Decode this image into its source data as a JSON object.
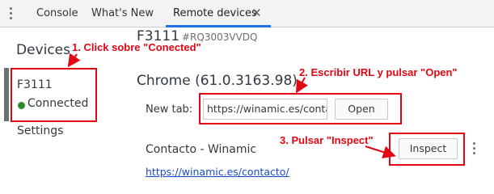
{
  "tabs": [
    {
      "label": "Console",
      "active": false
    },
    {
      "label": "What's New",
      "active": false
    },
    {
      "label": "Remote devices",
      "active": true
    }
  ],
  "sidebar": {
    "title": "Devices",
    "device": {
      "name": "F3111",
      "status": "Connected"
    },
    "settings_label": "Settings"
  },
  "device_panel": {
    "model": "F3111",
    "serial": "#RQ3003VVDQ",
    "browser": "Chrome (61.0.3163.98)",
    "new_tab_label": "New tab:",
    "url_value": "https://winamic.es/contacto/",
    "open_label": "Open",
    "page": {
      "title": "Contacto - Winamic",
      "url": "https://winamic.es/contacto/",
      "inspect_label": "Inspect"
    }
  },
  "annotations": {
    "step1": "1. Click sobre \"Conected\"",
    "step2": "2. Escribir URL y pulsar \"Open\"",
    "step3": "3. Pulsar \"Inspect\""
  },
  "colors": {
    "annotation_red": "#e30613",
    "active_tab_underline": "#1a73e8",
    "status_connected": "#2e8b2e",
    "link": "#1a4cc7"
  }
}
